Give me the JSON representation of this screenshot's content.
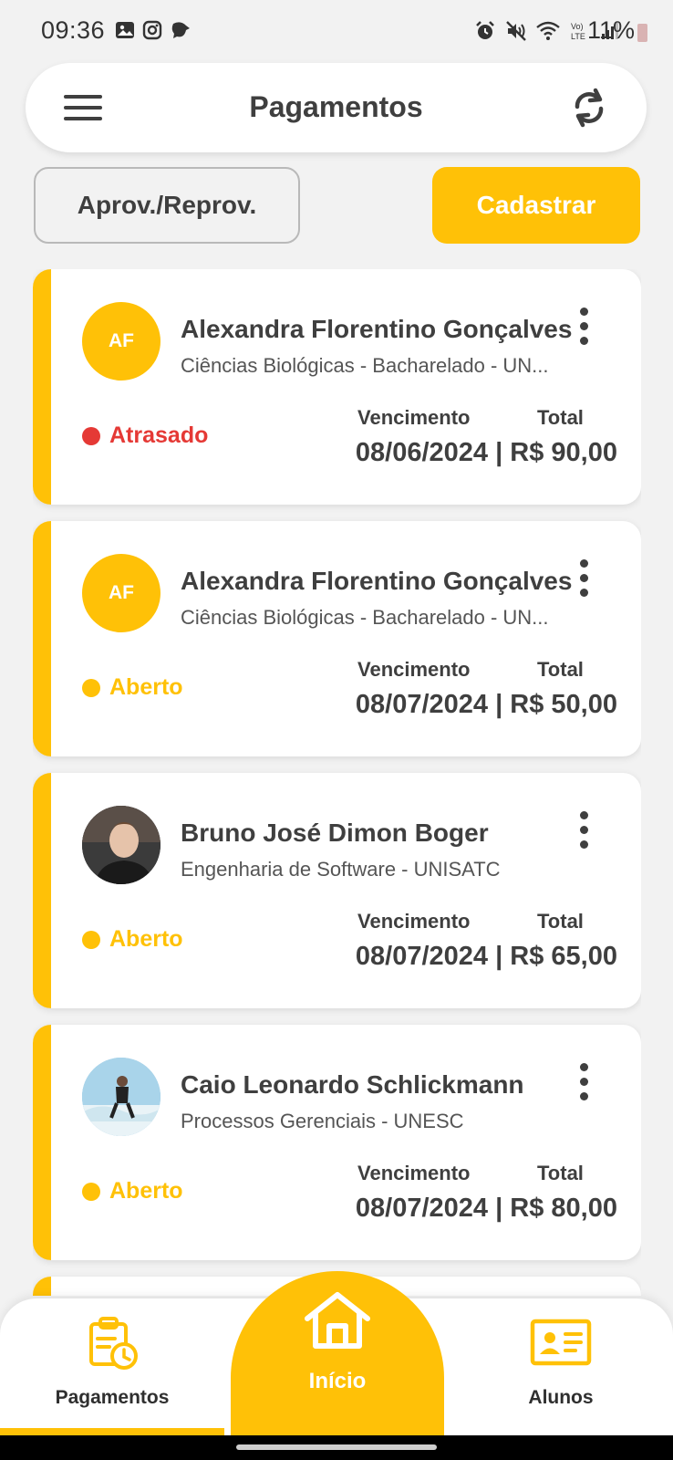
{
  "status_bar": {
    "time": "09:36",
    "battery": "11%"
  },
  "header": {
    "title": "Pagamentos"
  },
  "actions": {
    "approve_label": "Aprov./Reprov.",
    "register_label": "Cadastrar"
  },
  "labels": {
    "vencimento": "Vencimento",
    "total": "Total"
  },
  "colors": {
    "accent": "#ffc107",
    "late": "#e53935",
    "open": "#ffc107"
  },
  "payments": [
    {
      "initials": "AF",
      "name": "Alexandra Florentino Gonçalves",
      "course": "Ciências Biológicas - Bacharelado - UN...",
      "status": "Atrasado",
      "due_total": "08/06/2024 | R$ 90,00"
    },
    {
      "initials": "AF",
      "name": "Alexandra Florentino Gonçalves",
      "course": "Ciências Biológicas - Bacharelado - UN...",
      "status": "Aberto",
      "due_total": "08/07/2024 | R$ 50,00"
    },
    {
      "initials": "",
      "name": "Bruno José Dimon Boger",
      "course": "Engenharia de Software - UNISATC",
      "status": "Aberto",
      "due_total": "08/07/2024 | R$ 65,00"
    },
    {
      "initials": "",
      "name": "Caio Leonardo Schlickmann",
      "course": "Processos Gerenciais - UNESC",
      "status": "Aberto",
      "due_total": "08/07/2024 | R$ 80,00"
    }
  ],
  "bottom_nav": {
    "payments_label": "Pagamentos",
    "home_label": "Início",
    "students_label": "Alunos"
  }
}
